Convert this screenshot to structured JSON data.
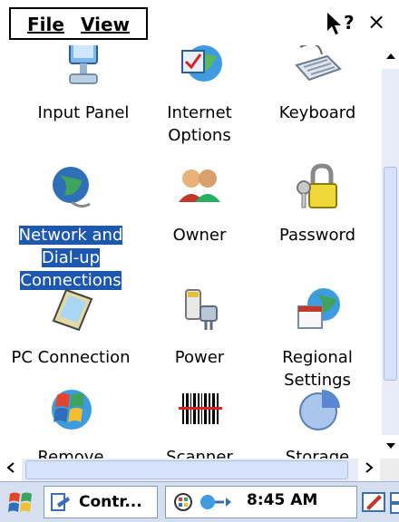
{
  "menubar": {
    "file_label": "File",
    "view_label": "View",
    "help_label": "?",
    "close_label": "×"
  },
  "items": [
    {
      "label": "Input Panel"
    },
    {
      "label": "Internet Options"
    },
    {
      "label": "Keyboard"
    },
    {
      "label": "Network and Dial-up Connections"
    },
    {
      "label": "Owner"
    },
    {
      "label": "Password"
    },
    {
      "label": "PC Connection"
    },
    {
      "label": "Power"
    },
    {
      "label": "Regional Settings"
    },
    {
      "label": "Remove"
    },
    {
      "label": "Scanner"
    },
    {
      "label": "Storage"
    }
  ],
  "taskbar": {
    "task_label": "Contr...",
    "time": "8:45 AM"
  }
}
